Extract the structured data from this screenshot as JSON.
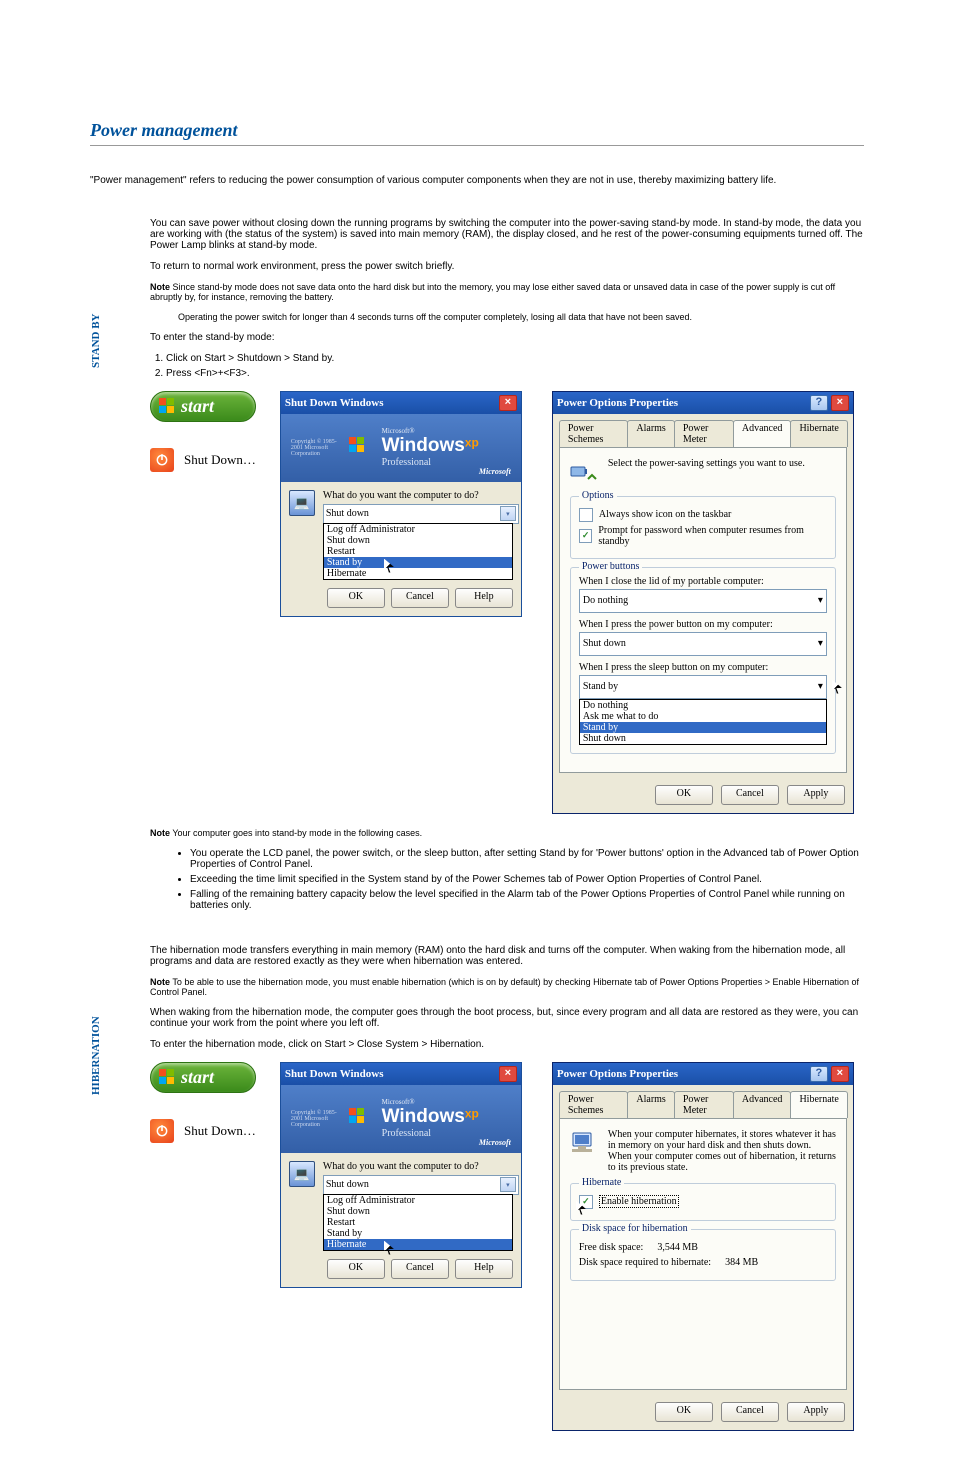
{
  "page": {
    "title": "Power management",
    "intro": "\"Power management\" refers to reducing the power consumption of various computer components when they are not in use, thereby maximizing battery life."
  },
  "standby": {
    "heading": "STAND BY",
    "p1": "You can save power without closing down the running programs by switching the computer into the power-saving stand-by mode. In stand-by mode, the data you are working with (the status of the system) is saved into main memory (RAM), the display closed, and he rest of the power-consuming equipments turned off. The Power Lamp blinks at stand-by mode.",
    "p2": "To return to normal work environment, press the power switch briefly.",
    "n1": "Since stand-by mode does not save data onto the hard disk but into the memory, you may lose either saved data or unsaved data in case of the power supply is cut off abruptly by, for instance, removing the battery.",
    "n2": "Operating the power switch for longer than 4 seconds turns off the computer completely, losing all data that have not been saved.",
    "stepsIntro": "To enter the stand-by mode:",
    "steps": [
      "Click on Start > Shutdown > Stand by.",
      "Press <Fn>+<F3>."
    ],
    "note3Label": "Note",
    "note3": "Your computer goes into stand-by mode in the following cases.",
    "bul1": "You operate the LCD panel, the power switch, or the sleep button, after setting Stand by for 'Power buttons' option in the Advanced tab of Power Option Properties of Control Panel.",
    "bul2": "Exceeding the time limit specified in the System stand by of the Power Schemes tab of Power Option Properties of Control Panel.",
    "bul3": "Falling of the remaining battery capacity below the level specified in the Alarm tab of the Power Options Properties of Control Panel while running on batteries only."
  },
  "hibernate": {
    "heading": "HIBERNATION",
    "p1": "The hibernation mode transfers everything in main memory (RAM) onto the hard disk and turns off the computer. When waking from the hibernation mode, all programs and data are restored exactly as they were when hibernation was entered.",
    "n1": "To be able to use the hibernation mode, you must enable hibernation (which is on by default) by checking Hibernate tab of Power Options Properties > Enable Hibernation of Control Panel.",
    "p2": "When waking from the hibernation mode, the computer goes through the boot process, but, since every program and all data are restored as they were, you can continue your work from the point where you left off.",
    "p3": "To enter the hibernation mode, click on Start > Close System > Hibernation."
  },
  "startButton": {
    "label": "start"
  },
  "shutDown": {
    "label": "Shut Down…"
  },
  "sdDialog": {
    "title": "Shut Down Windows",
    "brandMs": "Microsoft®",
    "brandBig": "Windows",
    "brandXp": "xp",
    "brandPro": "Professional",
    "copy": "Copyright © 1985-2001\nMicrosoft Corporation",
    "msr": "Microsoft",
    "question": "What do you want the computer to do?",
    "current": "Shut down",
    "options": [
      "Log off Administrator",
      "Shut down",
      "Restart",
      "Stand by",
      "Hibernate"
    ],
    "ok": "OK",
    "cancel": "Cancel",
    "help": "Help"
  },
  "pp1": {
    "title": "Power Options Properties",
    "tabs": [
      "Power Schemes",
      "Alarms",
      "Power Meter",
      "Advanced",
      "Hibernate"
    ],
    "activeTab": "Advanced",
    "desc": "Select the power-saving settings you want to use.",
    "optGroup": "Options",
    "opt1": "Always show icon on the taskbar",
    "opt2": "Prompt for password when computer resumes from standby",
    "pbGroup": "Power buttons",
    "lid": "When I close the lid of my portable computer:",
    "lidVal": "Do nothing",
    "pwr": "When I press the power button on my computer:",
    "pwrVal": "Shut down",
    "sleep": "When I press the sleep button on my computer:",
    "sleepVal": "Stand by",
    "sleepOptions": [
      "Do nothing",
      "Ask me what to do",
      "Stand by",
      "Shut down"
    ],
    "ok": "OK",
    "cancel": "Cancel",
    "apply": "Apply"
  },
  "pp2": {
    "title": "Power Options Properties",
    "tabs": [
      "Power Schemes",
      "Alarms",
      "Power Meter",
      "Advanced",
      "Hibernate"
    ],
    "activeTab": "Hibernate",
    "desc": "When your computer hibernates, it stores whatever it has in memory on your hard disk and then shuts down. When your computer comes out of hibernation, it returns to its previous state.",
    "hGroup": "Hibernate",
    "hOpt": "Enable hibernation",
    "dGroup": "Disk space for hibernation",
    "freeLabel": "Free disk space:",
    "freeVal": "3,544 MB",
    "reqLabel": "Disk space required to hibernate:",
    "reqVal": "384 MB",
    "ok": "OK",
    "cancel": "Cancel",
    "apply": "Apply"
  }
}
